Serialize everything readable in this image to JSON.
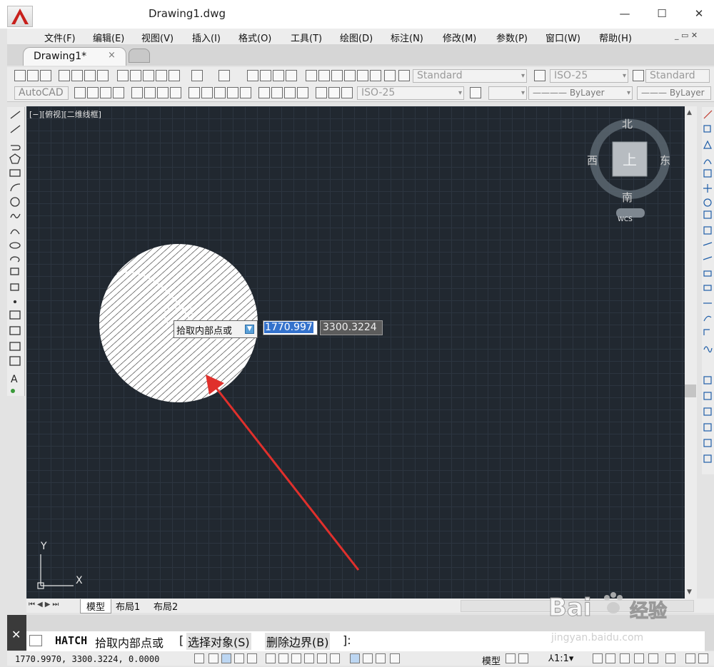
{
  "colors": {
    "accent": "#c8201c",
    "canvas": "#212830",
    "selection": "#3472cc",
    "arrow": "#e0302c"
  },
  "window": {
    "title": "Drawing1.dwg",
    "minimize": "—",
    "maximize": "☐",
    "close": "✕",
    "logo": "A"
  },
  "menu": [
    "文件(F)",
    "编辑(E)",
    "视图(V)",
    "插入(I)",
    "格式(O)",
    "工具(T)",
    "绘图(D)",
    "标注(N)",
    "修改(M)",
    "参数(P)",
    "窗口(W)",
    "帮助(H)"
  ],
  "doc_tab": {
    "label": "Drawing1*",
    "close": "×"
  },
  "toolbar1": {
    "text_style": "Standard",
    "dim_style": "ISO-25",
    "table_style": "Standard"
  },
  "toolbar2": {
    "workspace": "AutoCAD",
    "dim_style": "ISO-25",
    "linetype": "ByLayer",
    "lineweight": "ByLayer"
  },
  "viewport_label": "[−][俯视][二维线框]",
  "viewcube": {
    "north": "北",
    "south": "南",
    "east": "东",
    "west": "西",
    "face": "上",
    "wcs": "WCS"
  },
  "ucs": {
    "y": "Y",
    "x": "X"
  },
  "dynamic_input": {
    "prompt": "拾取内部点或",
    "x_value": "1770.997",
    "y_value": "3300.3224"
  },
  "layout_tabs": [
    "模型",
    "布局1",
    "布局2"
  ],
  "command_line": {
    "prefix": "HATCH",
    "prompt": "拾取内部点或",
    "opt1": "选择对象(S)",
    "opt2": "删除边界(B)",
    "close": "✕"
  },
  "status": {
    "coords": "1770.9970, 3300.3224, 0.0000",
    "model": "模型",
    "scale": "1:1"
  },
  "watermark": {
    "brand": "Bai",
    "brand2": "经验",
    "url": "jingyan.baidu.com"
  }
}
